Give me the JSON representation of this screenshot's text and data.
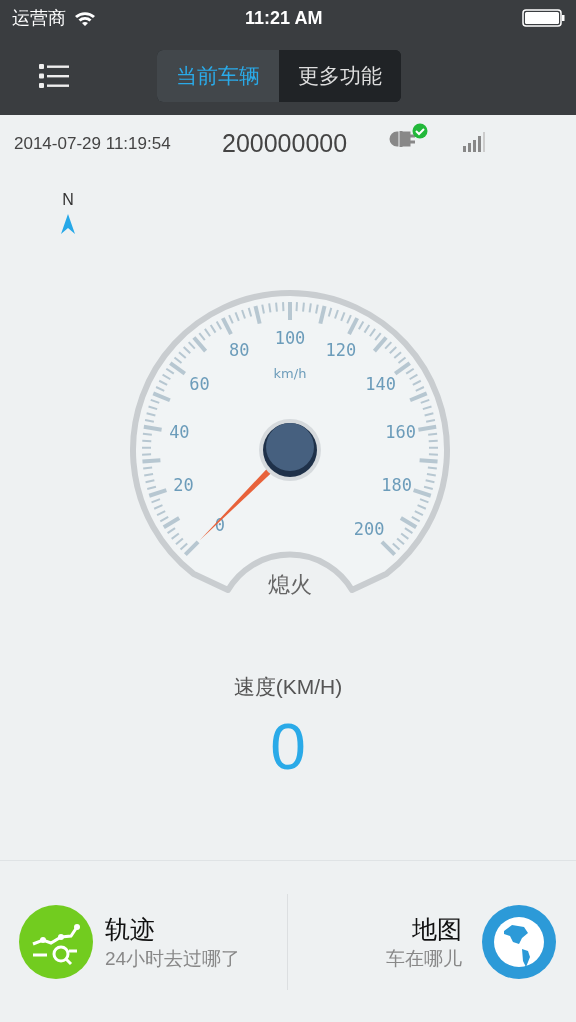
{
  "status_bar": {
    "carrier": "运营商",
    "time": "11:21 AM"
  },
  "nav": {
    "tabs": [
      {
        "label": "当前车辆",
        "selected": true
      },
      {
        "label": "更多功能",
        "selected": false
      }
    ]
  },
  "info": {
    "timestamp": "2014-07-29 11:19:54",
    "device_id": "200000000",
    "connected": true
  },
  "compass": {
    "label": "N"
  },
  "gauge": {
    "unit": "km/h",
    "labels": [
      "0",
      "20",
      "40",
      "60",
      "80",
      "100",
      "120",
      "140",
      "160",
      "180",
      "200"
    ],
    "engine_status": "熄火"
  },
  "speed": {
    "label": "速度(KM/H)",
    "value": "0"
  },
  "actions": [
    {
      "kind": "track",
      "title": "轨迹",
      "subtitle": "24小时去过哪了"
    },
    {
      "kind": "map",
      "title": "地图",
      "subtitle": "车在哪儿"
    }
  ]
}
